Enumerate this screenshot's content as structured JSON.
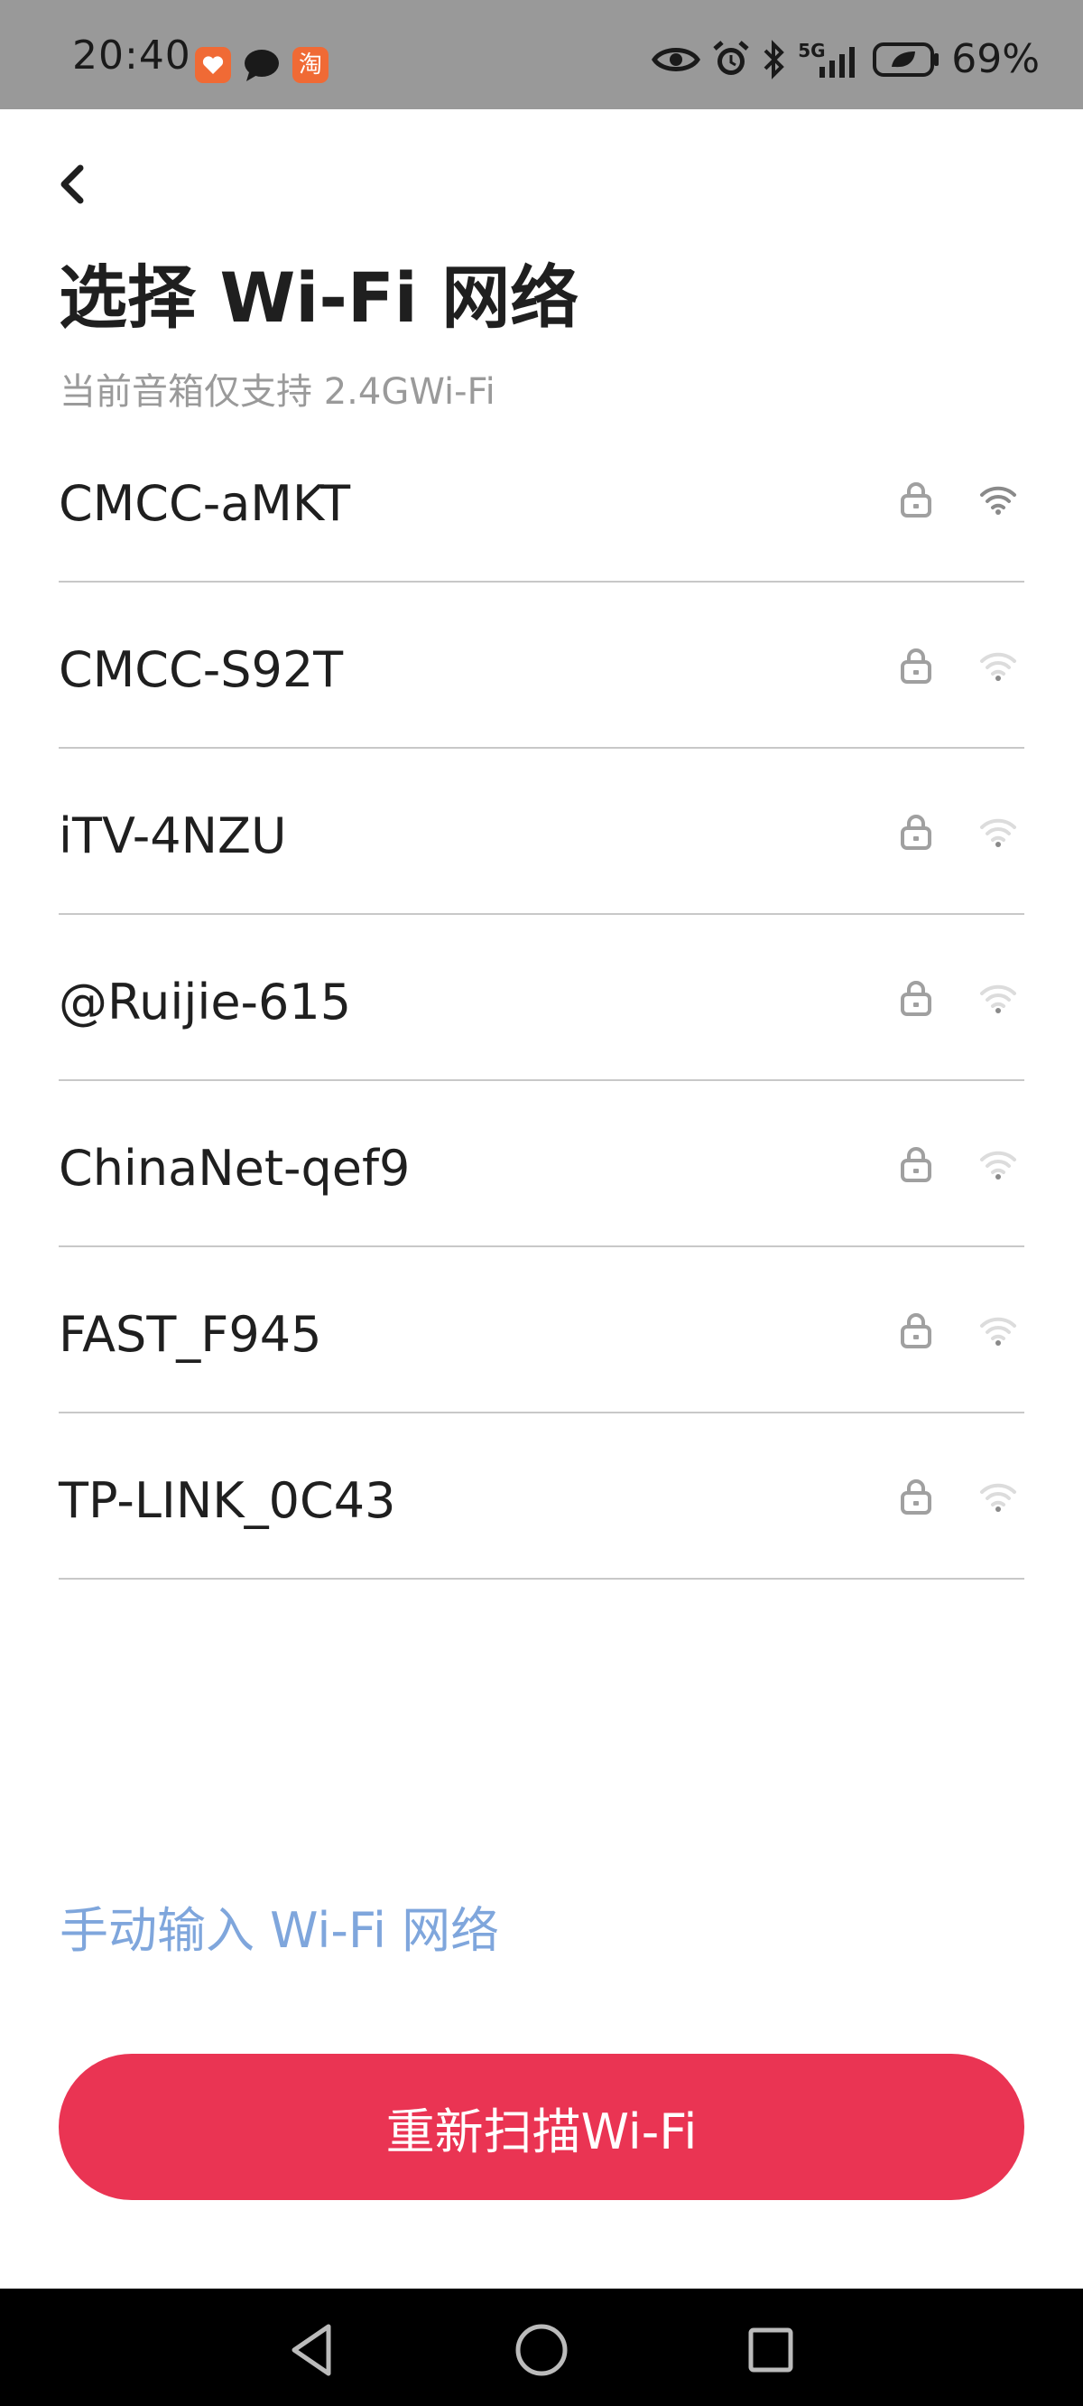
{
  "status_bar": {
    "time": "20:40",
    "app_badge_taobao": "淘",
    "battery_percent": "69%",
    "network_label": "5G",
    "icons": [
      "calendar-heart-icon",
      "chat-bubble-icon",
      "taobao-icon",
      "eye-icon",
      "alarm-icon",
      "bluetooth-icon",
      "signal-5g-icon",
      "battery-icon"
    ]
  },
  "header": {
    "back_icon": "chevron-left-icon",
    "title": "选择 Wi-Fi 网络",
    "subtitle": "当前音箱仅支持 2.4GWi-Fi"
  },
  "networks": [
    {
      "ssid": "CMCC-aMKT",
      "secured": true,
      "signal_level": 3
    },
    {
      "ssid": "CMCC-S92T",
      "secured": true,
      "signal_level": 1
    },
    {
      "ssid": "iTV-4NZU",
      "secured": true,
      "signal_level": 1
    },
    {
      "ssid": "@Ruijie-615",
      "secured": true,
      "signal_level": 1
    },
    {
      "ssid": "ChinaNet-qef9",
      "secured": true,
      "signal_level": 1
    },
    {
      "ssid": "FAST_F945",
      "secured": true,
      "signal_level": 1
    },
    {
      "ssid": "TP-LINK_0C43",
      "secured": true,
      "signal_level": 1
    }
  ],
  "actions": {
    "manual_entry_label": "手动输入 Wi-Fi 网络",
    "rescan_label": "重新扫描Wi-Fi"
  },
  "colors": {
    "accent_red": "#ea3453",
    "link_blue": "#7fa6dc",
    "status_bar_gray": "#999999",
    "signal_active": "#8a8a8a",
    "signal_inactive": "#dcdcdc",
    "lock_gray": "#a0a0a0"
  },
  "nav_bar": {
    "icons": [
      "back-triangle-icon",
      "home-circle-icon",
      "recents-square-icon"
    ]
  }
}
